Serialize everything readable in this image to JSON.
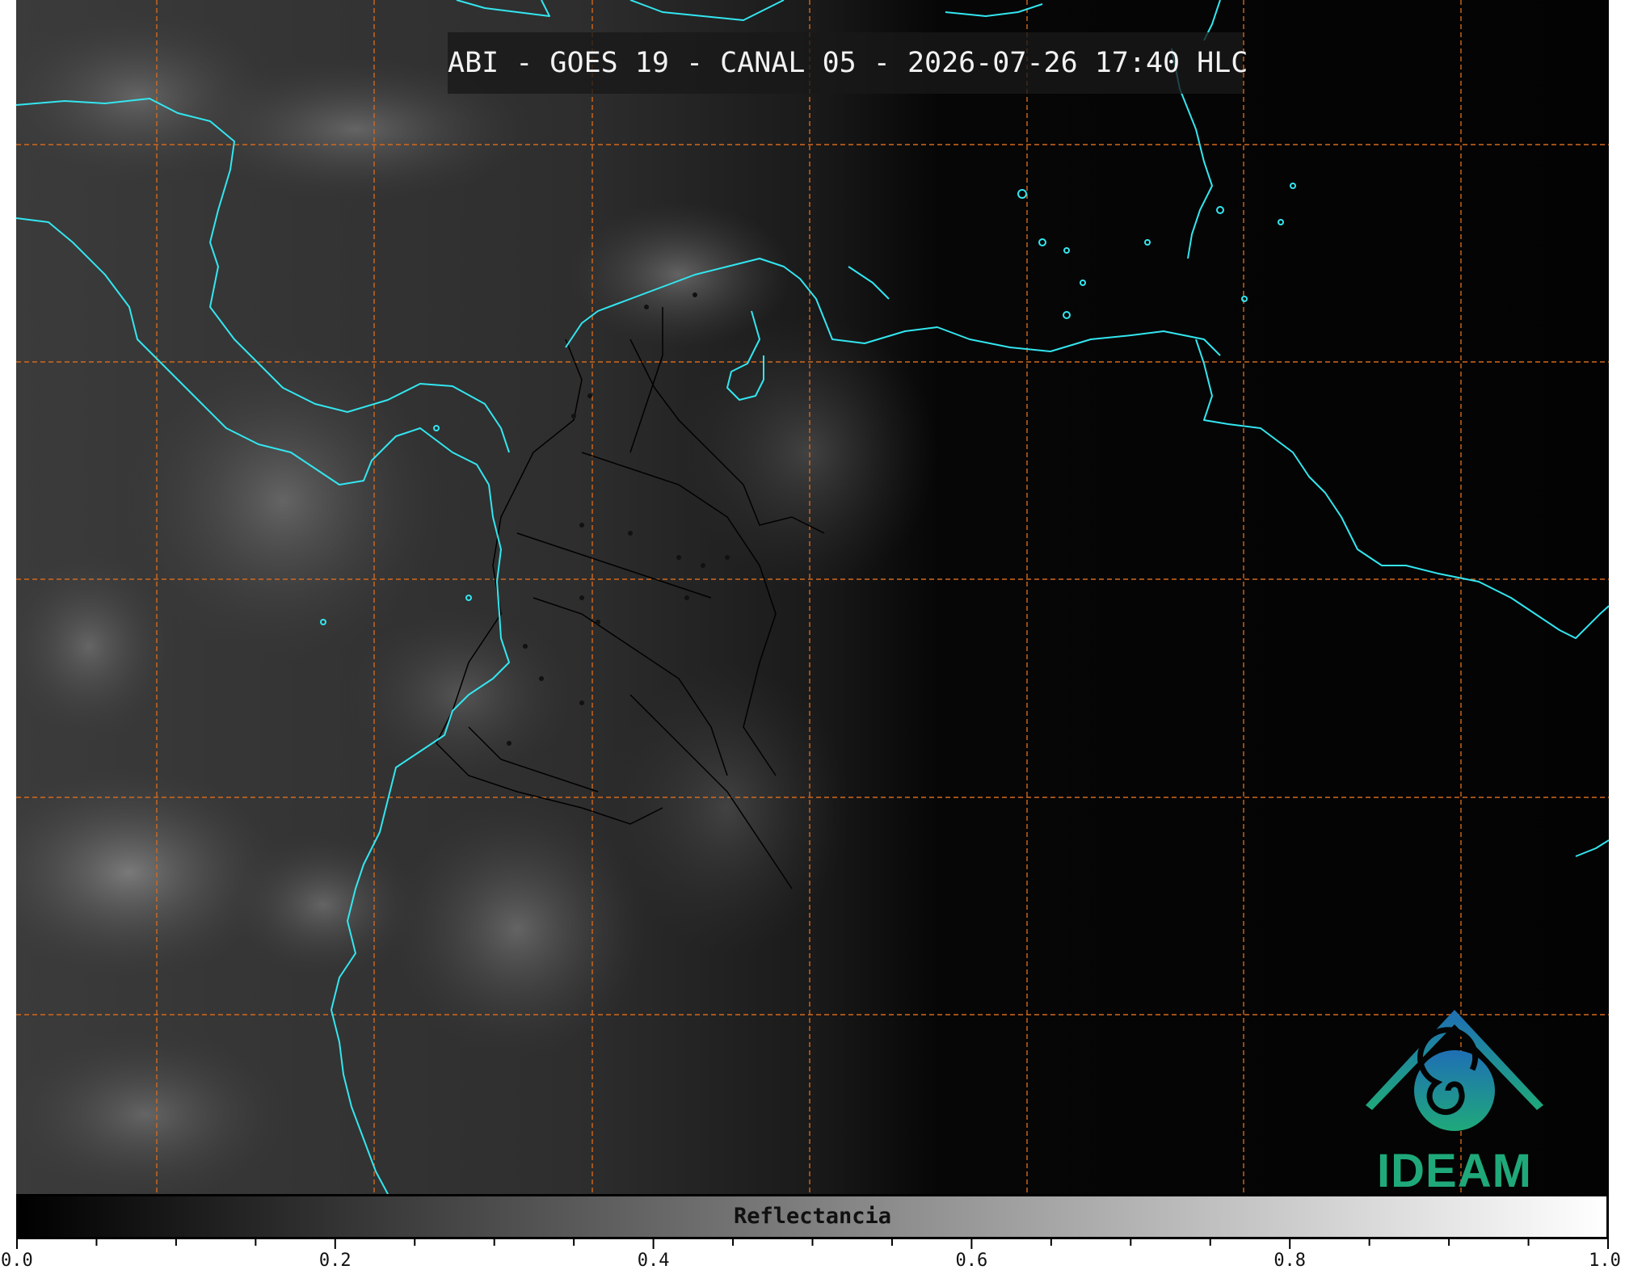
{
  "title": "ABI - GOES 19 - CANAL 05 - 2026-07-26 17:40 HLC",
  "logo": {
    "text": "IDEAM",
    "color_blue": "#1f6fb5",
    "color_green": "#1fa97a"
  },
  "colorbar": {
    "label": "Reflectancia",
    "min": 0.0,
    "max": 1.0,
    "tick_labels": [
      "0.0",
      "0.2",
      "0.4",
      "0.6",
      "0.8",
      "1.0"
    ],
    "tick_values": [
      0.0,
      0.2,
      0.4,
      0.6,
      0.8,
      1.0
    ],
    "minor_step": 0.05,
    "gradient": [
      "#000000",
      "#ffffff"
    ]
  },
  "map": {
    "coastline_color": "#33e6f0",
    "gridline_color": "#d2691e",
    "border_color": "#000000"
  }
}
